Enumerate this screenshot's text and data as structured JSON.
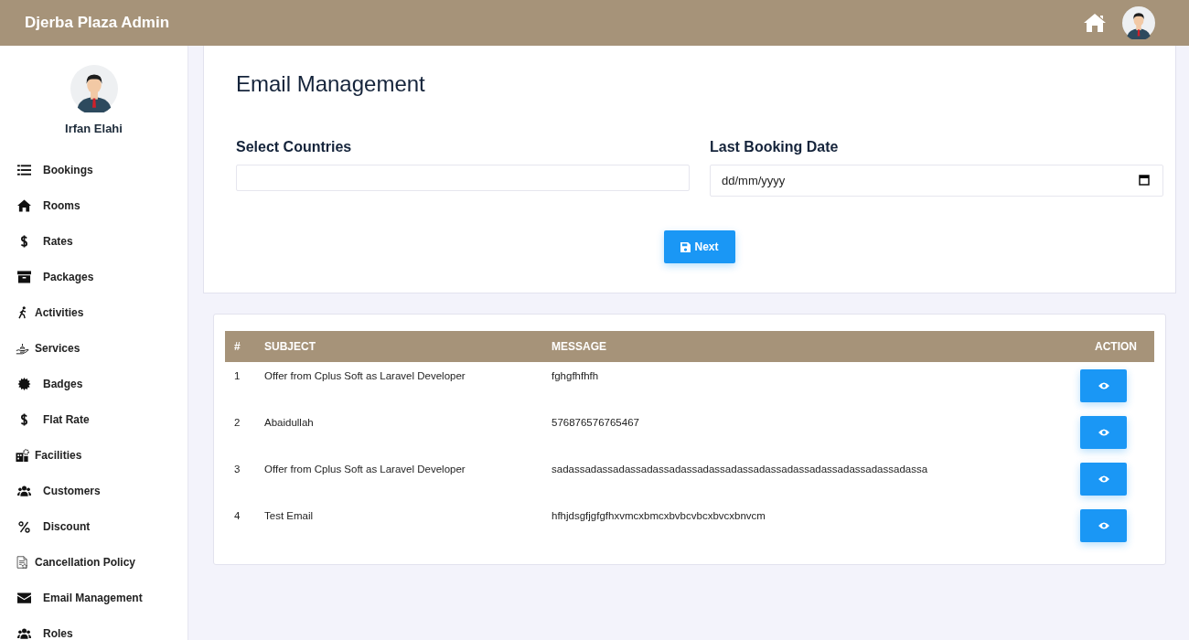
{
  "header": {
    "title": "Djerba Plaza Admin"
  },
  "sidebar": {
    "user_name": "Irfan Elahi",
    "items": [
      {
        "label": "Bookings",
        "kind": "list"
      },
      {
        "label": "Rooms",
        "kind": "home"
      },
      {
        "label": "Rates",
        "kind": "dollar"
      },
      {
        "label": "Packages",
        "kind": "archive"
      },
      {
        "label": "Activities",
        "kind": "runner"
      },
      {
        "label": "Services",
        "kind": "hand"
      },
      {
        "label": "Badges",
        "kind": "badge"
      },
      {
        "label": "Flat Rate",
        "kind": "dollar"
      },
      {
        "label": "Facilities",
        "kind": "building"
      },
      {
        "label": "Customers",
        "kind": "users"
      },
      {
        "label": "Discount",
        "kind": "percent"
      },
      {
        "label": "Cancellation Policy",
        "kind": "document"
      },
      {
        "label": "Email Management",
        "kind": "envelope"
      },
      {
        "label": "Roles",
        "kind": "users"
      }
    ]
  },
  "form": {
    "title": "Email Management",
    "countries": {
      "label": "Select Countries"
    },
    "date": {
      "label": "Last Booking Date",
      "placeholder": "dd/mm/yyyy"
    },
    "button": "Next"
  },
  "table": {
    "columns": [
      "#",
      "SUBJECT",
      "MESSAGE",
      "ACTION"
    ],
    "rows": [
      {
        "number": "1",
        "subject": "Offer from Cplus Soft as Laravel Developer",
        "message": "fghgfhfhfh"
      },
      {
        "number": "2",
        "subject": "Abaidullah",
        "message": "576876576765467"
      },
      {
        "number": "3",
        "subject": "Offer from Cplus Soft as Laravel Developer",
        "message": "sadassadassadassadassadassadassadassadassadassadassadassadassadassa"
      },
      {
        "number": "4",
        "subject": "Test Email",
        "message": "hfhjdsgfjgfgfhxvmcxbmcxbvbcvbcxbvcxbnvcm"
      }
    ]
  }
}
